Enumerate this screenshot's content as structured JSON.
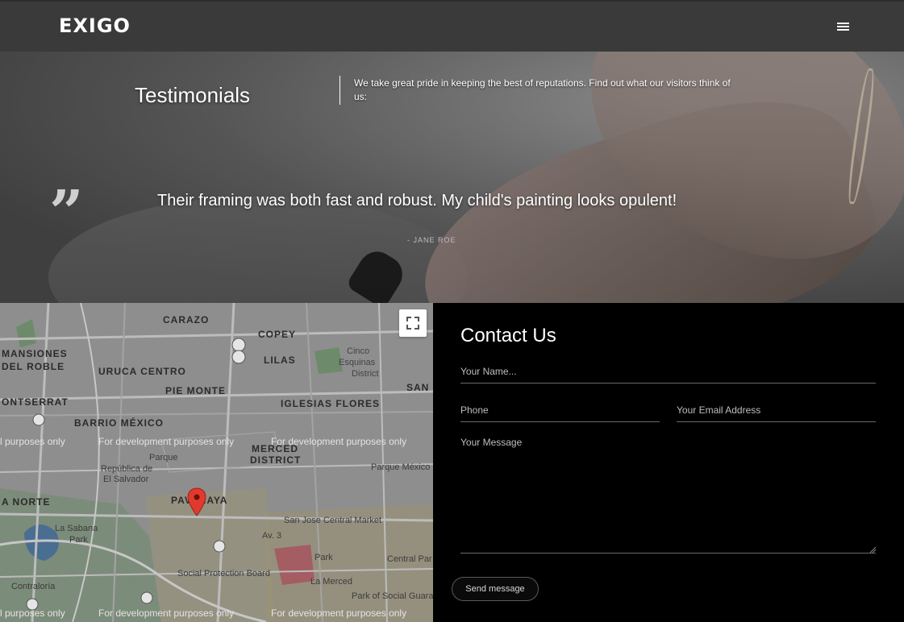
{
  "header": {
    "logo": "EXIGO",
    "menu_icon": "hamburger-menu-icon"
  },
  "testimonials": {
    "title": "Testimonials",
    "description": "We take great pride in keeping the best of reputations. Find out what our visitors think of us:",
    "quote_icon": "quote-icon",
    "quote_mark": "”",
    "quote": "Their framing was both fast and robust. My child's painting looks opulent!",
    "author": "- JANE ROE"
  },
  "map": {
    "fullscreen_icon": "fullscreen-icon",
    "marker_icon": "map-pin-icon",
    "districts": [
      "CARAZO",
      "COPEY",
      "MANSIONES",
      "DEL ROBLE",
      "LILAS",
      "URUCA CENTRO",
      "Cinco",
      "Esquinas",
      "District",
      "PIE MONTE",
      "SAN",
      "ONTSERRAT",
      "IGLESIAS FLORES",
      "BARRIO MÉXICO",
      "MERCED",
      "DISTRICT",
      "A NORTE",
      "PAVAHAYA"
    ],
    "places": [
      "República de",
      "El Salvador",
      "Parque",
      "Parque México",
      "La Sabana",
      "Park",
      "San Jose Central Market",
      "Av. 3",
      "Social Protection Board",
      "La Merced",
      "Park",
      "Central Par",
      "Park of Social Guarar",
      "Contraloría"
    ],
    "watermark": "For development purposes only",
    "watermark_left": "l purposes only"
  },
  "contact": {
    "title": "Contact Us",
    "name_placeholder": "Your Name...",
    "phone_placeholder": "Phone",
    "email_placeholder": "Your Email Address",
    "message_placeholder": "Your Message",
    "send_label": "Send message"
  }
}
